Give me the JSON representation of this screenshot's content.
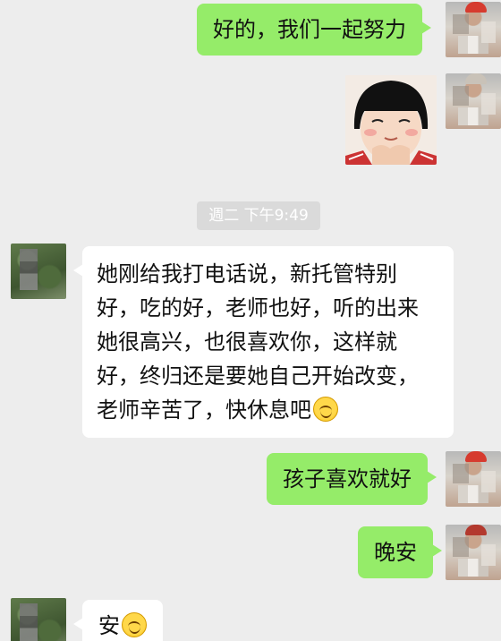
{
  "messages": [
    {
      "side": "right",
      "text": "好的，我们一起努力"
    },
    {
      "side": "right",
      "type": "sticker",
      "sticker": "girl-bangs-face-sticker"
    },
    {
      "type": "timestamp",
      "text": "週二 下午9:49"
    },
    {
      "side": "left",
      "lines": [
        "她刚给我打电话说，新托管特别",
        "好，吃的好，老师也好，听的出来",
        "她很高兴，也很喜欢你，这样就",
        "好，终归还是要她自己开始改变，",
        "老师辛苦了，快休息吧"
      ],
      "emoji": "smile-emoji"
    },
    {
      "side": "right",
      "text": "孩子喜欢就好"
    },
    {
      "side": "right",
      "text": "晚安"
    },
    {
      "side": "left",
      "text": "安",
      "emoji": "smile-emoji"
    }
  ],
  "colors": {
    "background": "#ededed",
    "outgoing_bubble": "#95ec69",
    "incoming_bubble": "#ffffff",
    "timestamp_bg": "#dadada"
  }
}
